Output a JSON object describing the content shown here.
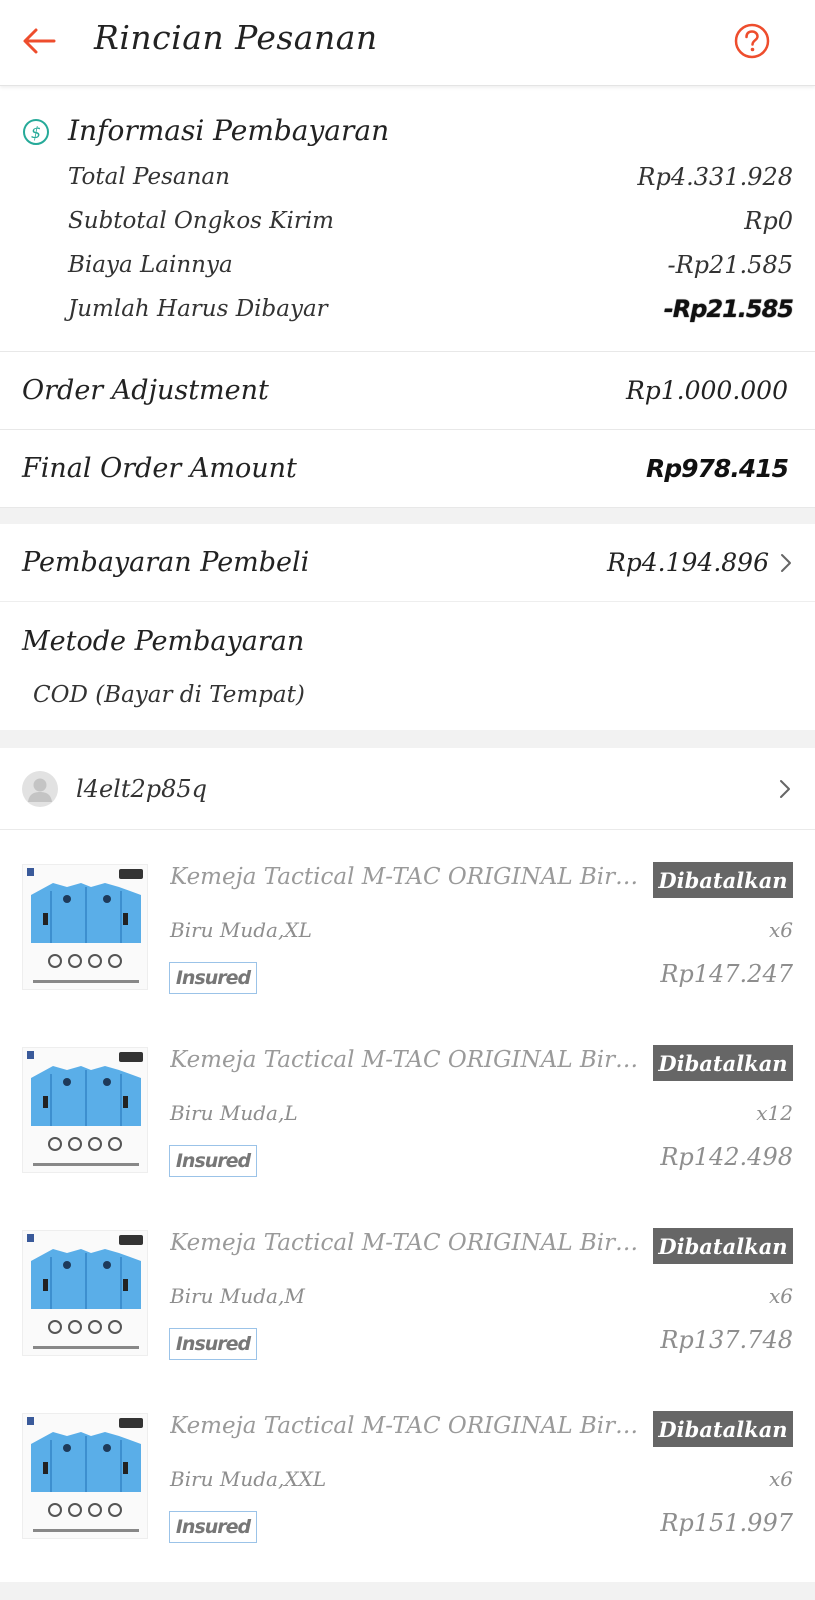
{
  "header": {
    "title": "Rincian Pesanan"
  },
  "payment_info": {
    "title": "Informasi Pembayaran",
    "rows": [
      {
        "label": "Total Pesanan",
        "value": "Rp4.331.928"
      },
      {
        "label": "Subtotal Ongkos Kirim",
        "value": "Rp0"
      },
      {
        "label": "Biaya Lainnya",
        "value": "-Rp21.585"
      },
      {
        "label": "Jumlah Harus Dibayar",
        "value": "-Rp21.585"
      }
    ]
  },
  "order_adjustment": {
    "label": "Order Adjustment",
    "value": "Rp1.000.000"
  },
  "final_order_amount": {
    "label": "Final Order Amount",
    "value": "Rp978.415"
  },
  "buyer_payment": {
    "label": "Pembayaran Pembeli",
    "value": "Rp4.194.896"
  },
  "payment_method": {
    "label": "Metode Pembayaran",
    "value": "COD (Bayar di Tempat)"
  },
  "buyer": {
    "username": "l4elt2p85q"
  },
  "items": [
    {
      "name": "Kemeja Tactical M-TAC ORIGINAL Biru Muda",
      "status": "Dibatalkan",
      "variant": "Biru Muda,XL",
      "qty": "x6",
      "insured": "Insured",
      "price": "Rp147.247"
    },
    {
      "name": "Kemeja Tactical M-TAC ORIGINAL Biru Muda",
      "status": "Dibatalkan",
      "variant": "Biru Muda,L",
      "qty": "x12",
      "insured": "Insured",
      "price": "Rp142.498"
    },
    {
      "name": "Kemeja Tactical M-TAC ORIGINAL Biru Muda",
      "status": "Dibatalkan",
      "variant": "Biru Muda,M",
      "qty": "x6",
      "insured": "Insured",
      "price": "Rp137.748"
    },
    {
      "name": "Kemeja Tactical M-TAC ORIGINAL Biru Muda",
      "status": "Dibatalkan",
      "variant": "Biru Muda,XXL",
      "qty": "x6",
      "insured": "Insured",
      "price": "Rp151.997"
    }
  ],
  "colors": {
    "accent": "#ee4d2d",
    "money_icon": "#26aa99",
    "badge_bg": "#666666",
    "shirt": "#5aaee8"
  },
  "icons": {
    "back": "arrow-left-icon",
    "help": "question-circle-icon",
    "payment": "dollar-circle-icon",
    "chevron": "chevron-right-icon",
    "avatar": "user-avatar-icon"
  }
}
